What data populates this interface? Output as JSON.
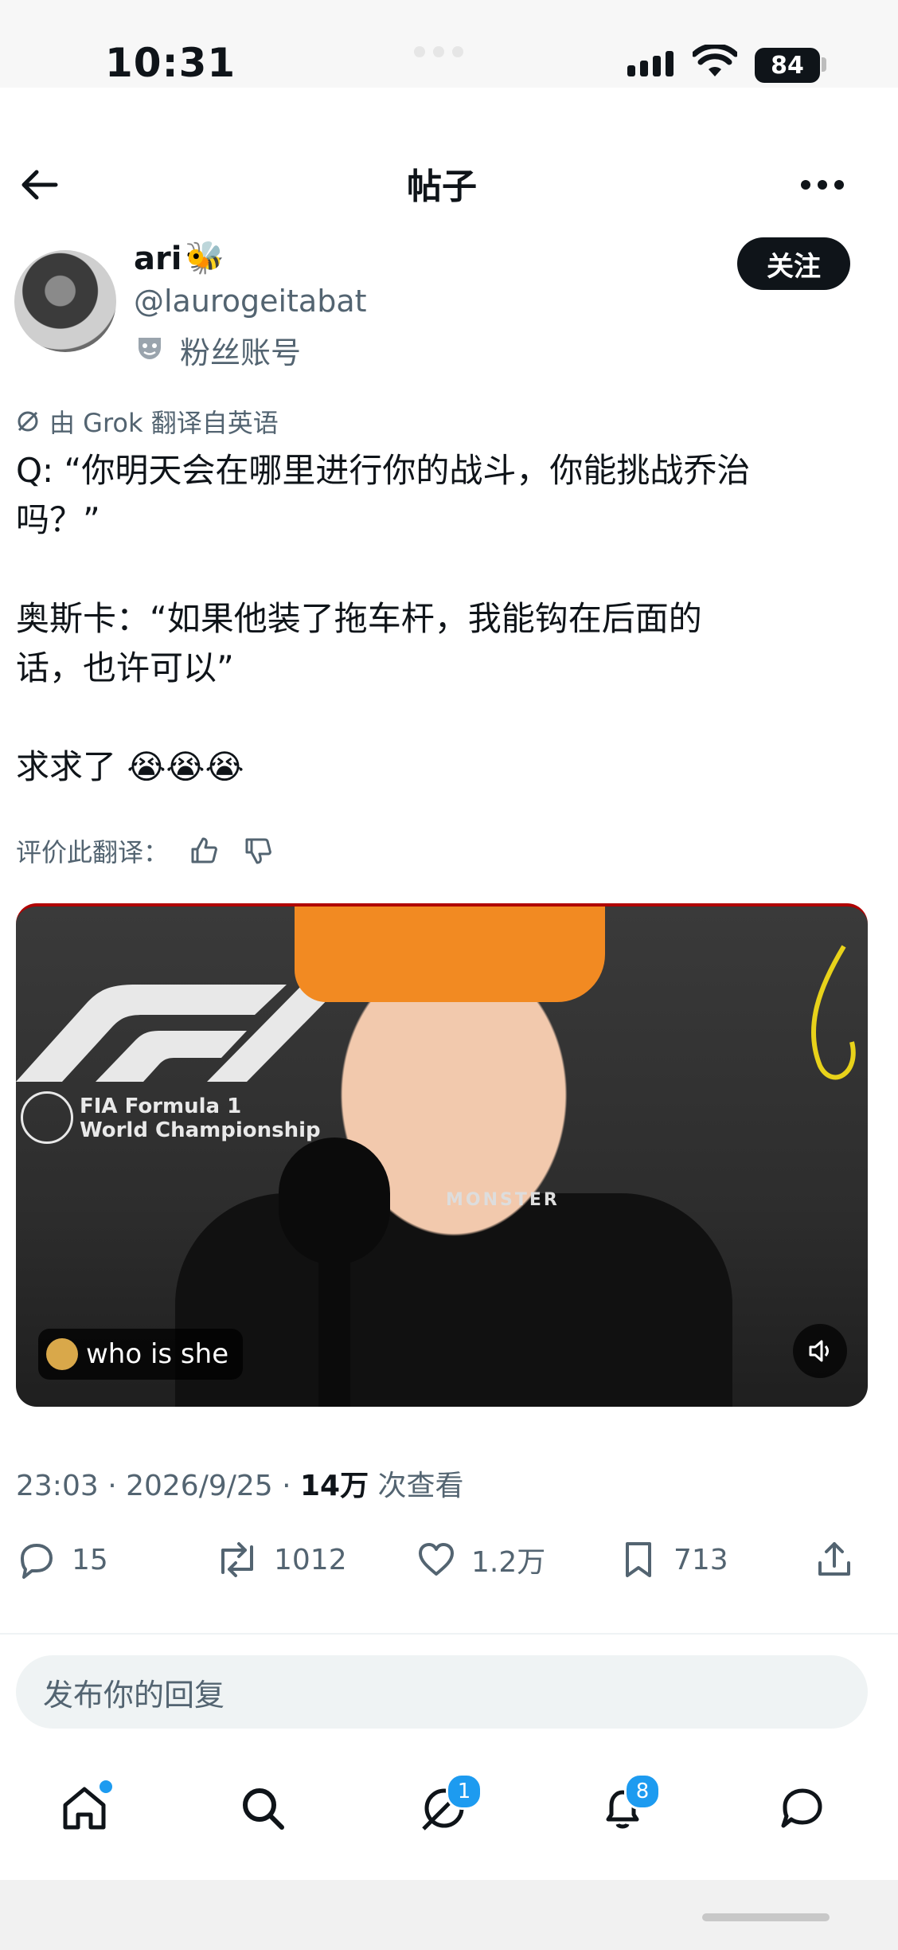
{
  "status_bar": {
    "time": "10:31",
    "battery": "84"
  },
  "header": {
    "title": "帖子"
  },
  "author": {
    "name": "ari",
    "emoji": "🐝",
    "handle": "@laurogeitabat",
    "badge_label": "粉丝账号",
    "follow_label": "关注"
  },
  "post": {
    "translation_note": "由 Grok 翻译自英语",
    "text": "Q: “你明天会在哪里进行你的战斗，你能挑战乔治\n吗？”\n\n奥斯卡：“如果他装了拖车杆，我能钩在后面的\n话，也许可以”\n\n求求了 😭😭😭",
    "rate_label": "评价此翻译：",
    "timestamp": "23:03 · 2026/9/25 · ",
    "views_count": "14万",
    "views_label": " 次查看"
  },
  "video": {
    "caption": "who is she",
    "logo_text": "FIA Formula 1\nWorld Championship",
    "sponsor_text": "MONSTER"
  },
  "actions": {
    "replies": "15",
    "reposts": "1012",
    "likes": "1.2万",
    "bookmarks": "713"
  },
  "reply_box": {
    "placeholder": "发布你的回复"
  },
  "tabs": {
    "grok_badge": "1",
    "notifications_badge": "8"
  },
  "colors": {
    "accent": "#1d9bf0",
    "text": "#0f1419",
    "muted": "#536471"
  }
}
